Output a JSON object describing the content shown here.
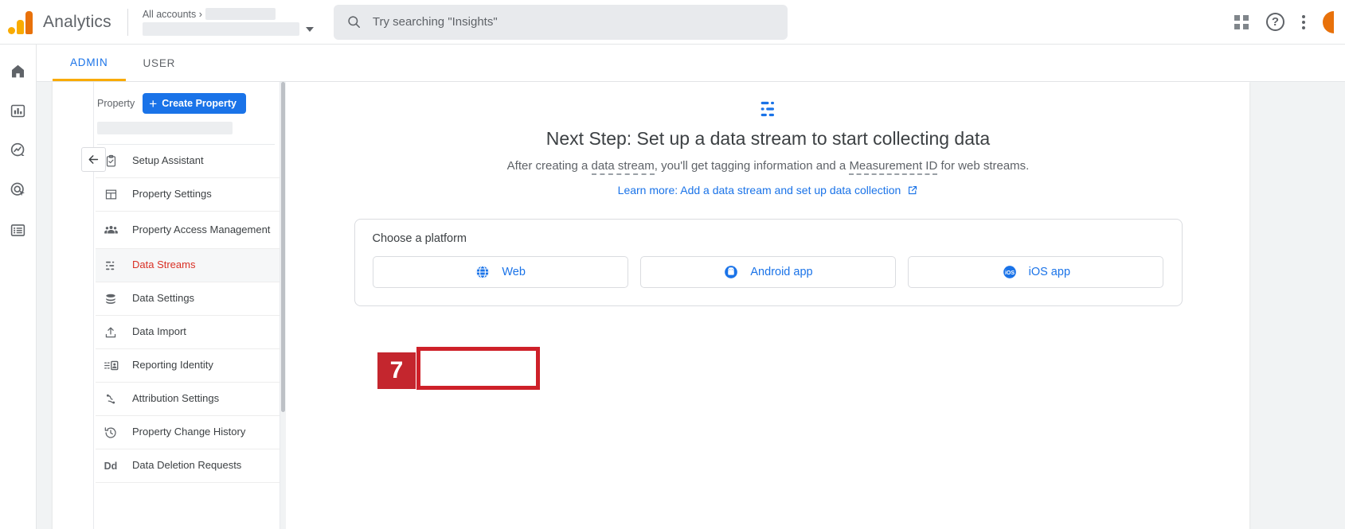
{
  "app": {
    "brand": "Analytics",
    "logo_colors": [
      "#F9AB00",
      "#E8710A"
    ]
  },
  "topbar": {
    "account_breadcrumb": "All accounts ›",
    "search_placeholder": "Try searching \"Insights\"",
    "search_value": "",
    "icons": [
      "apps-grid-icon",
      "help-icon",
      "kebab-menu-icon",
      "avatar-icon"
    ]
  },
  "rail": {
    "items": [
      {
        "name": "home",
        "icon": "home-icon"
      },
      {
        "name": "reports",
        "icon": "bar-chart-icon"
      },
      {
        "name": "explore",
        "icon": "explore-insights-icon"
      },
      {
        "name": "advertising",
        "icon": "advertising-target-icon"
      },
      {
        "name": "configure",
        "icon": "list-library-icon"
      }
    ]
  },
  "tabs": [
    {
      "label": "ADMIN",
      "active": true
    },
    {
      "label": "USER",
      "active": false
    }
  ],
  "property_nav": {
    "section_label": "Property",
    "create_button": "Create Property",
    "plus_glyph": "+",
    "items": [
      {
        "label": "Setup Assistant",
        "icon": "clipboard-check-icon",
        "selected": false
      },
      {
        "label": "Property Settings",
        "icon": "layout-panel-icon",
        "selected": false
      },
      {
        "label": "Property Access Management",
        "icon": "people-group-icon",
        "selected": false
      },
      {
        "label": "Data Streams",
        "icon": "data-streams-icon",
        "selected": true
      },
      {
        "label": "Data Settings",
        "icon": "database-stack-icon",
        "selected": false
      },
      {
        "label": "Data Import",
        "icon": "upload-icon",
        "selected": false
      },
      {
        "label": "Reporting Identity",
        "icon": "reporting-identity-icon",
        "selected": false
      },
      {
        "label": "Attribution Settings",
        "icon": "attribution-path-icon",
        "selected": false
      },
      {
        "label": "Property Change History",
        "icon": "history-clock-icon",
        "selected": false
      },
      {
        "label": "Data Deletion Requests",
        "icon": "dd-text-icon",
        "selected": false
      }
    ],
    "collapse_icon": "back-arrow-icon",
    "selected_color": "#D93025"
  },
  "main": {
    "glyph": "data-streams-blue-icon",
    "headline": "Next Step: Set up a data stream to start collecting data",
    "subline_parts": [
      "After creating a ",
      "data stream",
      ", you'll get tagging information and a ",
      "Measurement ID",
      " for web streams."
    ],
    "learn_more": "Learn more: Add a data stream and set up data collection",
    "learn_more_icon": "external-link-icon",
    "platform": {
      "title": "Choose a platform",
      "options": [
        {
          "label": "Web",
          "icon": "globe-icon"
        },
        {
          "label": "Android app",
          "icon": "android-icon"
        },
        {
          "label": "iOS app",
          "icon": "ios-icon"
        }
      ]
    }
  },
  "annotation": {
    "number": "7",
    "box_color": "#CE2029",
    "badge_color": "#C4262E",
    "targets": "Web"
  }
}
